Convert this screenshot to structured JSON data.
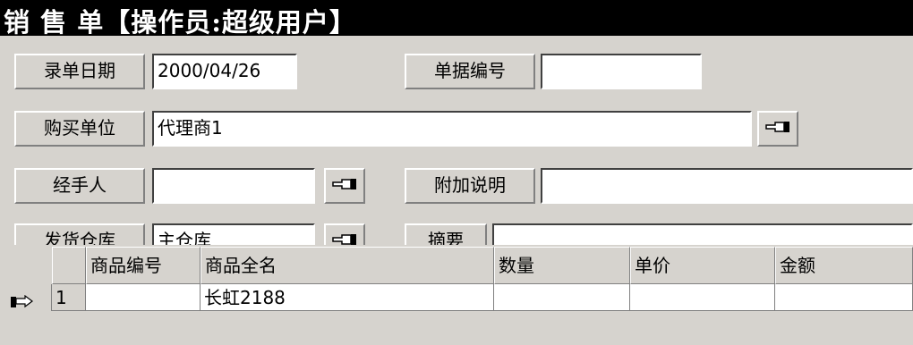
{
  "window": {
    "title": "销 售 单【操作员:超级用户】"
  },
  "form": {
    "entry_date": {
      "label": "录单日期",
      "value": "2000/04/26"
    },
    "doc_number": {
      "label": "单据编号",
      "value": ""
    },
    "buyer": {
      "label": "购买单位",
      "value": "代理商1"
    },
    "handler": {
      "label": "经手人",
      "value": ""
    },
    "extra_note": {
      "label": "附加说明",
      "value": ""
    },
    "warehouse": {
      "label": "发货仓库",
      "value": "主仓库"
    },
    "summary": {
      "label": "摘要",
      "value": ""
    }
  },
  "grid": {
    "columns": [
      "商品编号",
      "商品全名",
      "数量",
      "单价",
      "金额"
    ],
    "rows": [
      {
        "index": "1",
        "code": "",
        "name": "长虹2188",
        "qty": "",
        "price": "",
        "amount": ""
      }
    ]
  },
  "icons": {
    "lookup": "pointing-hand-icon",
    "row_pointer": "pointing-hand-icon"
  }
}
